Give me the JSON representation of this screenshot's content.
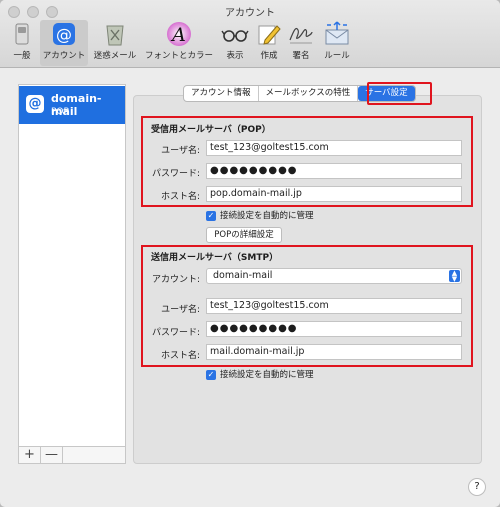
{
  "window": {
    "title": "アカウント"
  },
  "toolbar": {
    "items": [
      {
        "label": "一般",
        "icon": "switch-icon"
      },
      {
        "label": "アカウント",
        "icon": "at-icon"
      },
      {
        "label": "迷惑メール",
        "icon": "trash-junk-icon"
      },
      {
        "label": "フォントとカラー",
        "icon": "font-color-icon"
      },
      {
        "label": "表示",
        "icon": "glasses-icon"
      },
      {
        "label": "作成",
        "icon": "pencil-icon"
      },
      {
        "label": "署名",
        "icon": "signature-icon"
      },
      {
        "label": "ルール",
        "icon": "rules-envelope-icon"
      }
    ]
  },
  "sidebar": {
    "account": {
      "name": "domain-mail",
      "type": "POP"
    },
    "add_label": "+",
    "remove_label": "—"
  },
  "tabs": [
    {
      "label": "アカウント情報"
    },
    {
      "label": "メールボックスの特性"
    },
    {
      "label": "サーバ設定"
    }
  ],
  "incoming": {
    "title": "受信用メールサーバ（POP）",
    "username_label": "ユーザ名:",
    "username": "test_123@goltest15.com",
    "password_label": "パスワード:",
    "password": "●●●●●●●●●",
    "host_label": "ホスト名:",
    "host": "pop.domain-mail.jp",
    "auto_manage": "接続設定を自動的に管理",
    "advanced_button": "POPの詳細設定"
  },
  "outgoing": {
    "title": "送信用メールサーバ（SMTP）",
    "account_label": "アカウント:",
    "account_value": "domain-mail",
    "username_label": "ユーザ名:",
    "username": "test_123@goltest15.com",
    "password_label": "パスワード:",
    "password": "●●●●●●●●●",
    "host_label": "ホスト名:",
    "host": "mail.domain-mail.jp",
    "auto_manage": "接続設定を自動的に管理"
  },
  "help_label": "?",
  "colors": {
    "accent": "#2a73e4",
    "highlight": "#e0141e",
    "selection": "#1f6fe0"
  }
}
